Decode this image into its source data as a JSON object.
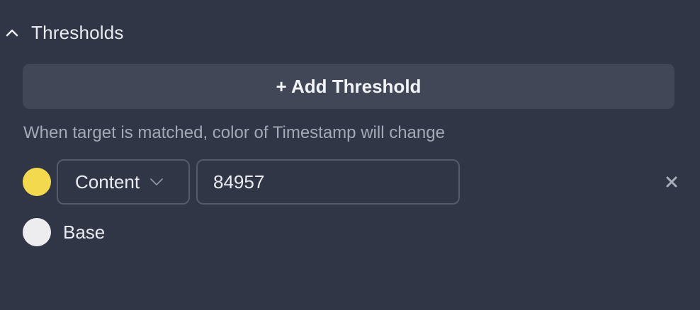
{
  "section": {
    "title": "Thresholds",
    "chevron_icon": "chevron-up-icon"
  },
  "add_threshold": {
    "label": "+ Add Threshold"
  },
  "hint": {
    "text": "When target is matched, color of Timestamp will change"
  },
  "thresholds": [
    {
      "color": "#f2d94e",
      "field": "Content",
      "value": "84957",
      "remove_icon": "close-icon"
    }
  ],
  "base": {
    "label": "Base",
    "color": "#ededf0"
  },
  "colors": {
    "background": "#313646",
    "button_bg": "#414756",
    "border": "#555b6a",
    "muted_text": "#a4a9b6",
    "icon": "#a8adb9"
  }
}
